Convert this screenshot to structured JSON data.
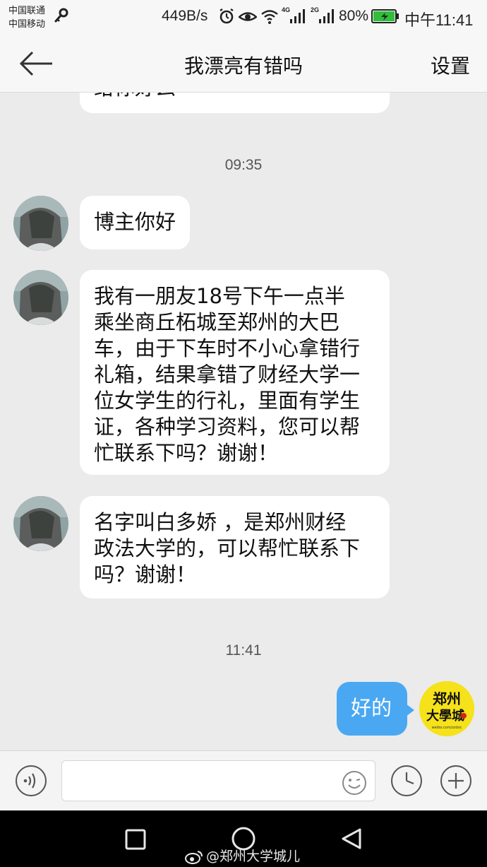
{
  "status_bar": {
    "carrier_1": "中国联通",
    "carrier_2": "中国移动",
    "net_speed": "449B/s",
    "net_4g": "4G",
    "net_2g": "2G",
    "battery_percent": "80%",
    "time": "中午11:41"
  },
  "header": {
    "title": "我漂亮有错吗",
    "settings_label": "设置"
  },
  "chat": {
    "partial_message": "给你好么",
    "timestamp_1": "09:35",
    "messages": [
      {
        "from": "other",
        "text": "博主你好"
      },
      {
        "from": "other",
        "lines": [
          "我有一朋友18号下午一点半",
          "乘坐商丘柘城至郑州的大巴",
          "车，由于下车时不小心拿错行",
          "礼箱，结果拿错了财经大学一",
          "位女学生的行礼，里面有学生",
          "证，各种学习资料，您可以帮",
          "忙联系下吗？谢谢！"
        ]
      },
      {
        "from": "other",
        "lines": [
          "名字叫白多娇 ，是郑州财经",
          "政法大学的，可以帮忙联系下",
          "吗？谢谢！"
        ]
      }
    ],
    "timestamp_2": "11:41",
    "reply": {
      "from": "me",
      "text": "好的"
    },
    "my_avatar": {
      "line1": "郑州",
      "line2": "大學城",
      "small": "weibo.com/zzdxc"
    }
  },
  "input": {
    "placeholder": "",
    "value": ""
  },
  "watermark": "@郑州大学城儿",
  "colors": {
    "outgoing_bubble": "#4aa8f2",
    "incoming_bubble": "#ffffff",
    "chat_background": "#ebebeb",
    "my_avatar_bg": "#f5e21a"
  }
}
